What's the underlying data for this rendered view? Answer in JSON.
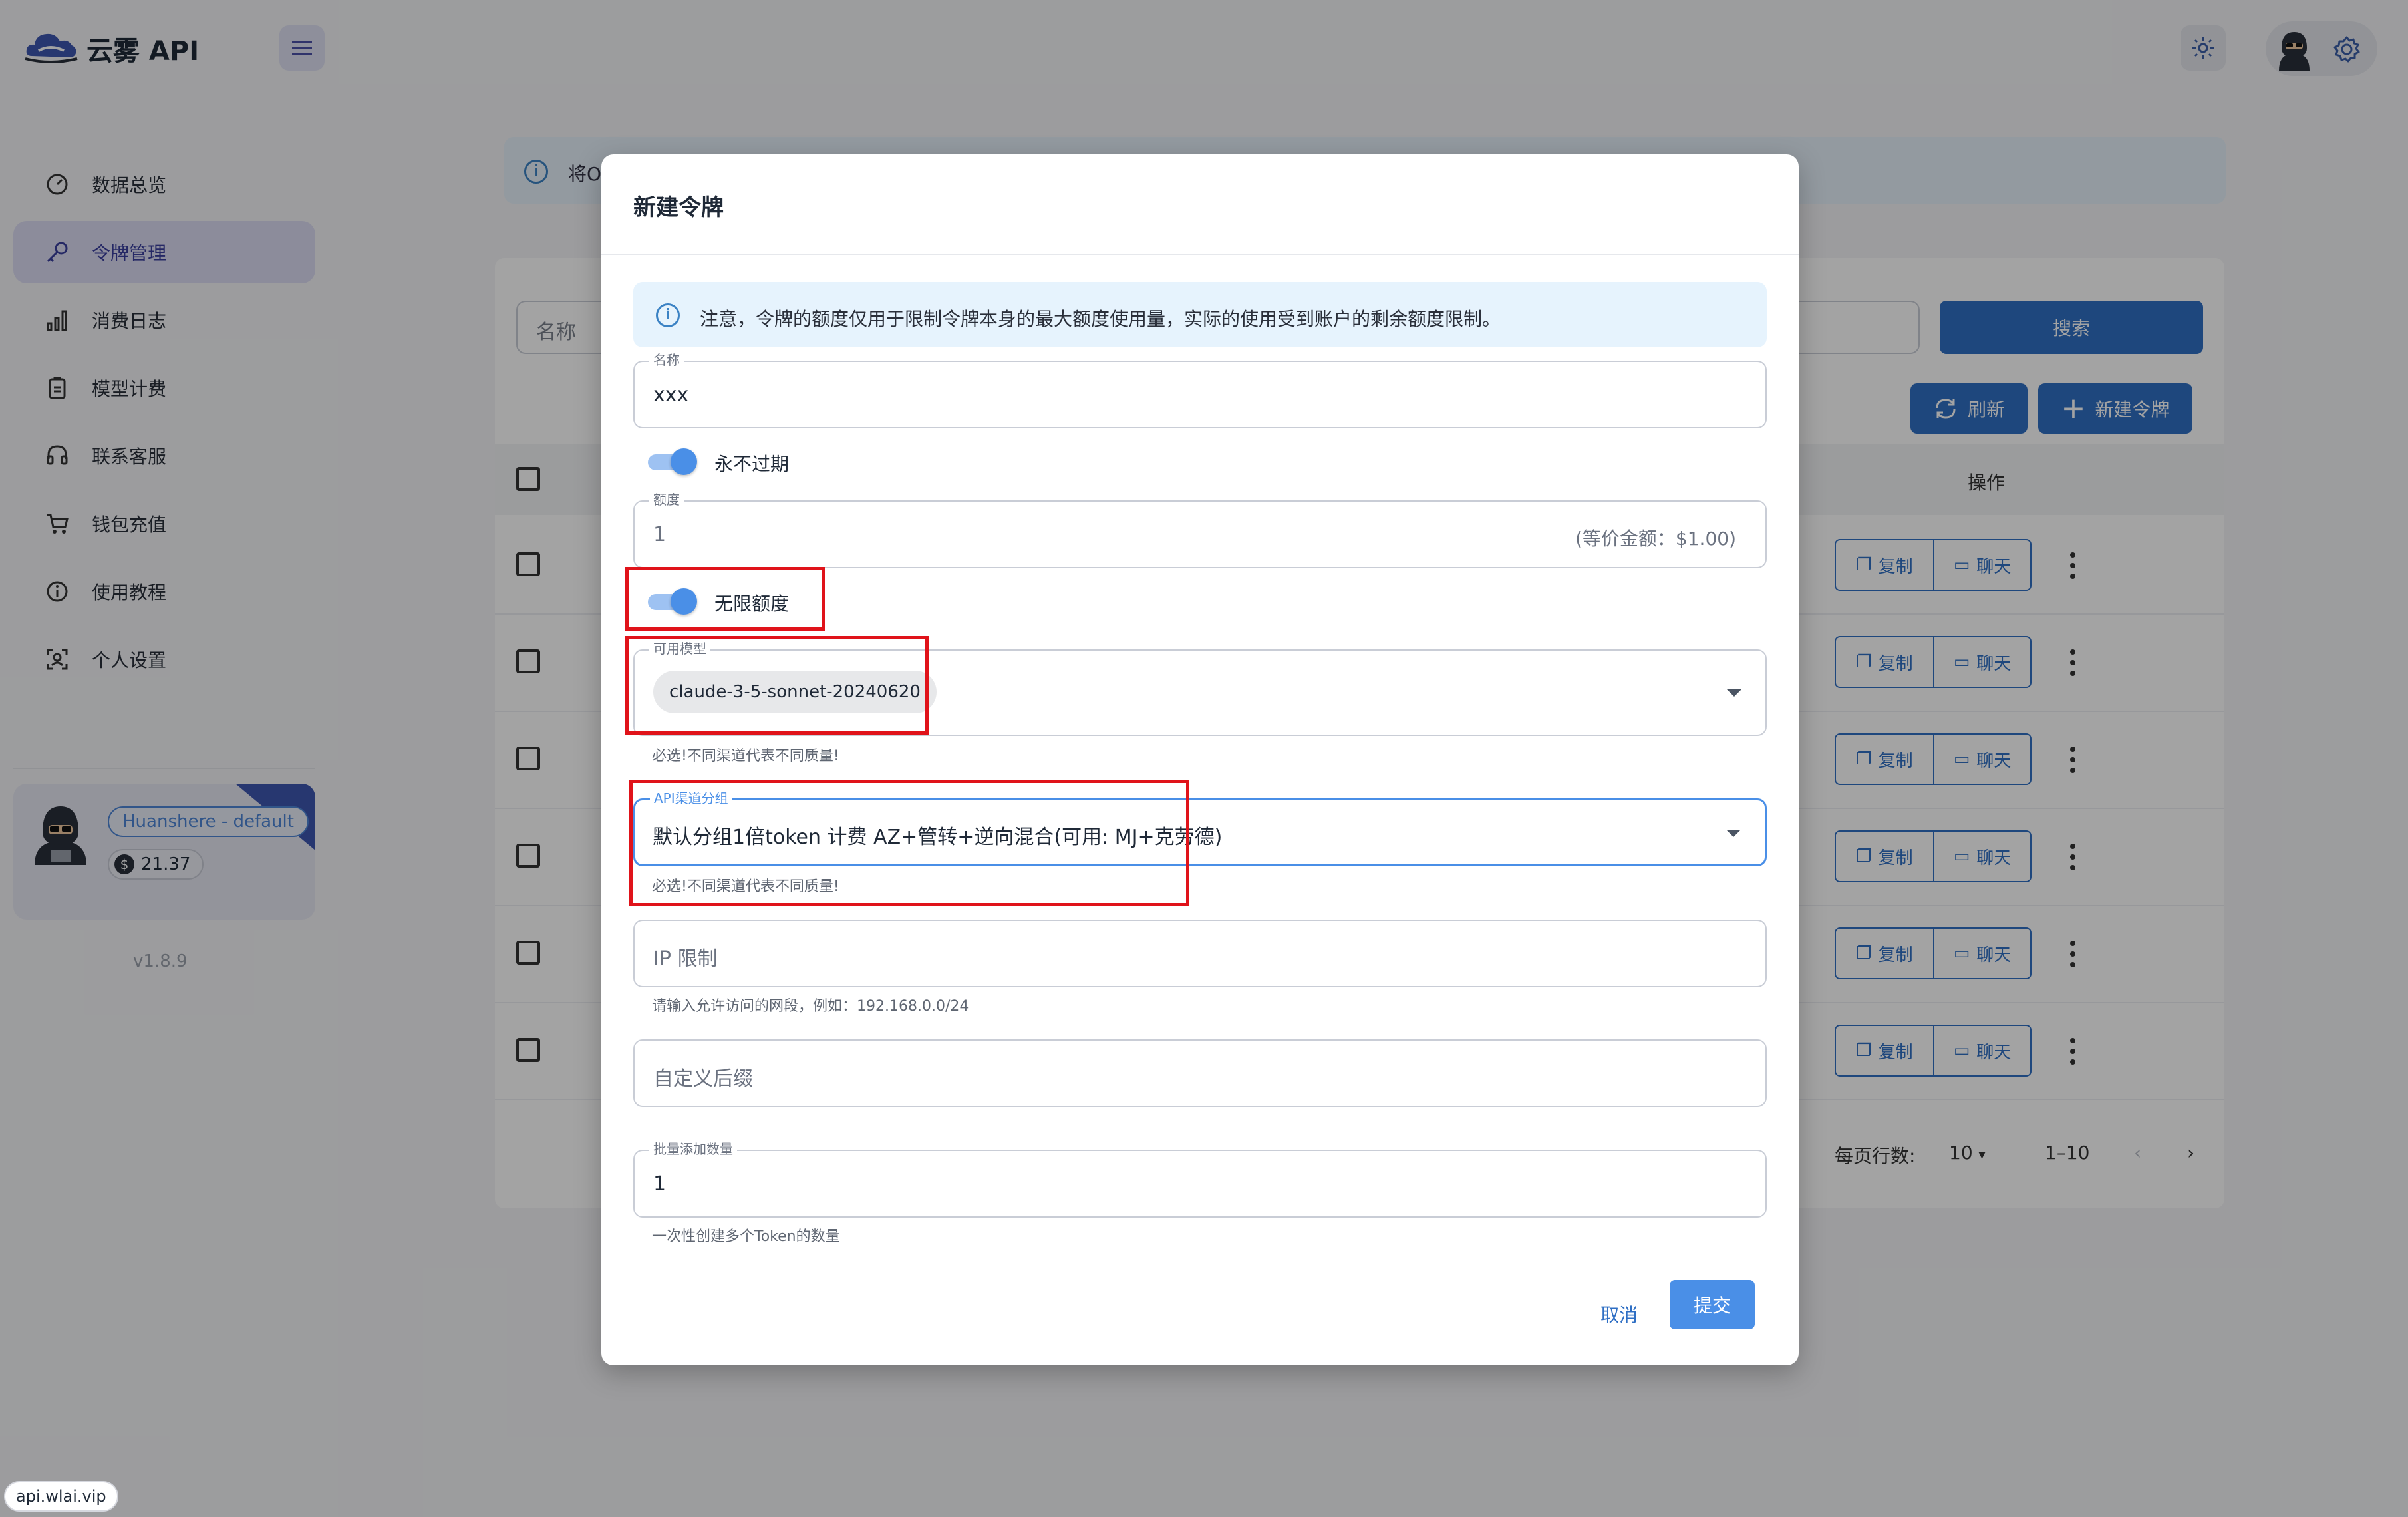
{
  "app": {
    "brand": "云雾 API"
  },
  "sidebar": {
    "items": [
      {
        "label": "数据总览",
        "icon": "dashboard-icon"
      },
      {
        "label": "令牌管理",
        "icon": "key-icon",
        "active": true
      },
      {
        "label": "消费日志",
        "icon": "bar-chart-icon"
      },
      {
        "label": "模型计费",
        "icon": "receipt-icon"
      },
      {
        "label": "联系客服",
        "icon": "headset-icon"
      },
      {
        "label": "钱包充值",
        "icon": "cart-icon"
      },
      {
        "label": "使用教程",
        "icon": "info-icon"
      },
      {
        "label": "个人设置",
        "icon": "user-settings-icon"
      }
    ],
    "user": {
      "name": "Huanshere - default",
      "balance": "21.37"
    },
    "version": "v1.8.9"
  },
  "background": {
    "notice": "将Op",
    "search_placeholder": "名称",
    "search_button": "搜索",
    "refresh_button": "刷新",
    "new_token_button": "新建令牌",
    "col_actions": "操作",
    "row_actions": {
      "copy": "复制",
      "chat": "聊天"
    },
    "pager": {
      "rows_label": "每页行数:",
      "rows_value": "10",
      "range": "1–10"
    }
  },
  "modal": {
    "title": "新建令牌",
    "info": "注意，令牌的额度仅用于限制令牌本身的最大额度使用量，实际的使用受到账户的剩余额度限制。",
    "name_label": "名称",
    "name_value": "xxx",
    "never_expire_label": "永不过期",
    "never_expire": true,
    "quota_label": "额度",
    "quota_value": "1",
    "quota_suffix": "(等价金额：$1.00)",
    "unlimited_label": "无限额度",
    "unlimited": true,
    "models_label": "可用模型",
    "models_selected": [
      "claude-3-5-sonnet-20240620"
    ],
    "models_helper": "必选!不同渠道代表不同质量!",
    "group_label": "API渠道分组",
    "group_value": "默认分组1倍token 计费 AZ+管转+逆向混合(可用: MJ+克劳德)",
    "group_helper": "必选!不同渠道代表不同质量!",
    "ip_placeholder": "IP 限制",
    "ip_helper": "请输入允许访问的网段，例如：192.168.0.0/24",
    "suffix_placeholder": "自定义后缀",
    "batch_label": "批量添加数量",
    "batch_value": "1",
    "batch_helper": "一次性创建多个Token的数量",
    "cancel": "取消",
    "submit": "提交"
  },
  "footer": {
    "url": "api.wlai.vip"
  },
  "colors": {
    "accent": "#4a8fe7",
    "primary_dark": "#2f6fc4",
    "highlight": "#e0131a",
    "overlay": "rgba(0,0,0,0.36)"
  }
}
